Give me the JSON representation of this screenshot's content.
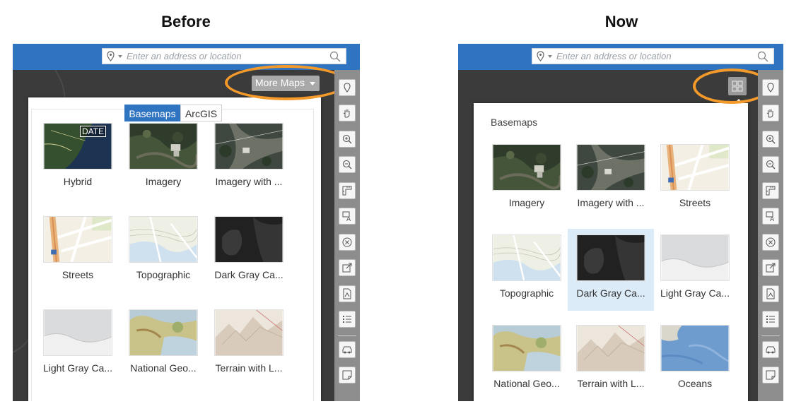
{
  "titles": {
    "before": "Before",
    "now": "Now"
  },
  "search": {
    "placeholder": "Enter an address or location"
  },
  "before": {
    "more_maps_label": "More Maps",
    "tabs": [
      "Basemaps",
      "ArcGIS"
    ],
    "date_badge": "DATE",
    "basemaps": [
      "Hybrid",
      "Imagery",
      "Imagery with ...",
      "Streets",
      "Topographic",
      "Dark Gray Ca...",
      "Light Gray Ca...",
      "National Geo...",
      "Terrain with L..."
    ]
  },
  "now": {
    "section_label": "Basemaps",
    "basemaps": [
      "Imagery",
      "Imagery with ...",
      "Streets",
      "Topographic",
      "Dark Gray Ca...",
      "Light Gray Ca...",
      "National Geo...",
      "Terrain with L...",
      "Oceans"
    ],
    "selected": "Dark Gray Ca..."
  },
  "tools": [
    "locate-icon",
    "pan-icon",
    "zoom-in-icon",
    "zoom-out-icon",
    "measure-icon",
    "label-icon",
    "clear-icon",
    "share-icon",
    "print-icon",
    "legend-icon",
    "directions-icon",
    "note-icon"
  ],
  "colors": {
    "topbar": "#2f74c1",
    "highlight": "#f39a2b",
    "selected": "#dcebf8",
    "tab_active": "#2f74c1"
  }
}
